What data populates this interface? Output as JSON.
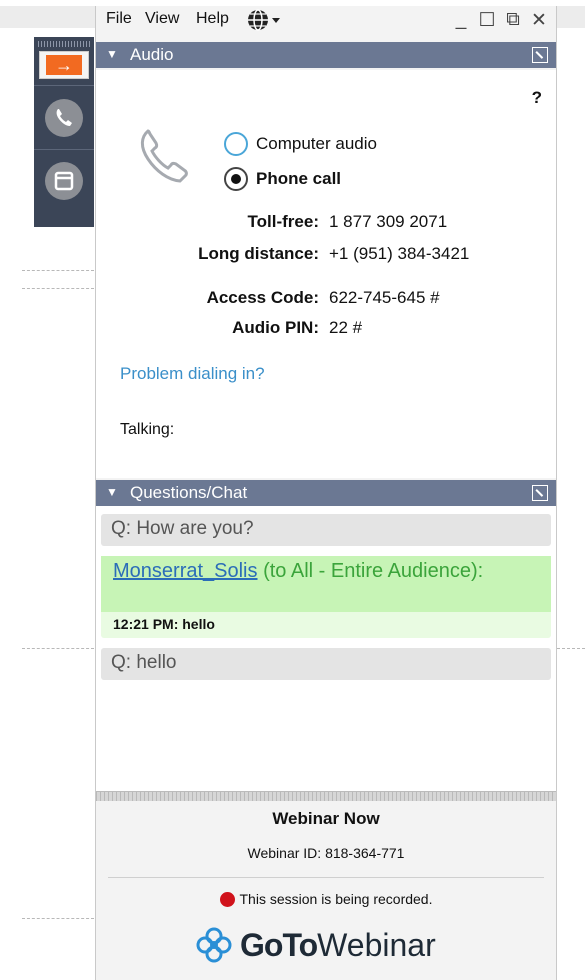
{
  "menu": {
    "file": "File",
    "view": "View",
    "help": "Help"
  },
  "window_controls": {
    "minimize": "_",
    "maximize": "☐",
    "restore": "⧉",
    "close": "✕"
  },
  "audio": {
    "section_title": "Audio",
    "help_mark": "?",
    "options": {
      "computer": "Computer audio",
      "phone": "Phone call",
      "selected": "phone"
    },
    "toll_free_label": "Toll-free:",
    "toll_free_value": "1 877 309 2071",
    "long_distance_label": "Long distance:",
    "long_distance_value": "+1 (951) 384-3421",
    "access_code_label": "Access Code:",
    "access_code_value": "622-745-645 #",
    "audio_pin_label": "Audio PIN:",
    "audio_pin_value": "22 #",
    "problem_link": "Problem dialing in?",
    "talking_label": "Talking:"
  },
  "chat": {
    "section_title": "Questions/Chat",
    "question1": "Q: How are you?",
    "message": {
      "sender": "Monserrat_Solis",
      "audience": " (to All - Entire Audience):",
      "body": "12:21 PM: hello"
    },
    "question2": "Q: hello"
  },
  "footer": {
    "title": "Webinar Now",
    "webinar_id": "Webinar ID: 818-364-771",
    "recording": "This session is being recorded.",
    "logo_bold": "GoTo",
    "logo_light": "Webinar"
  },
  "colors": {
    "section_bar": "#6b7893",
    "control_panel": "#3b4557",
    "arrow_orange": "#f26a21",
    "link_blue": "#3a8fc9",
    "chat_green": "#c7f4b6",
    "record_red": "#d0121b"
  }
}
